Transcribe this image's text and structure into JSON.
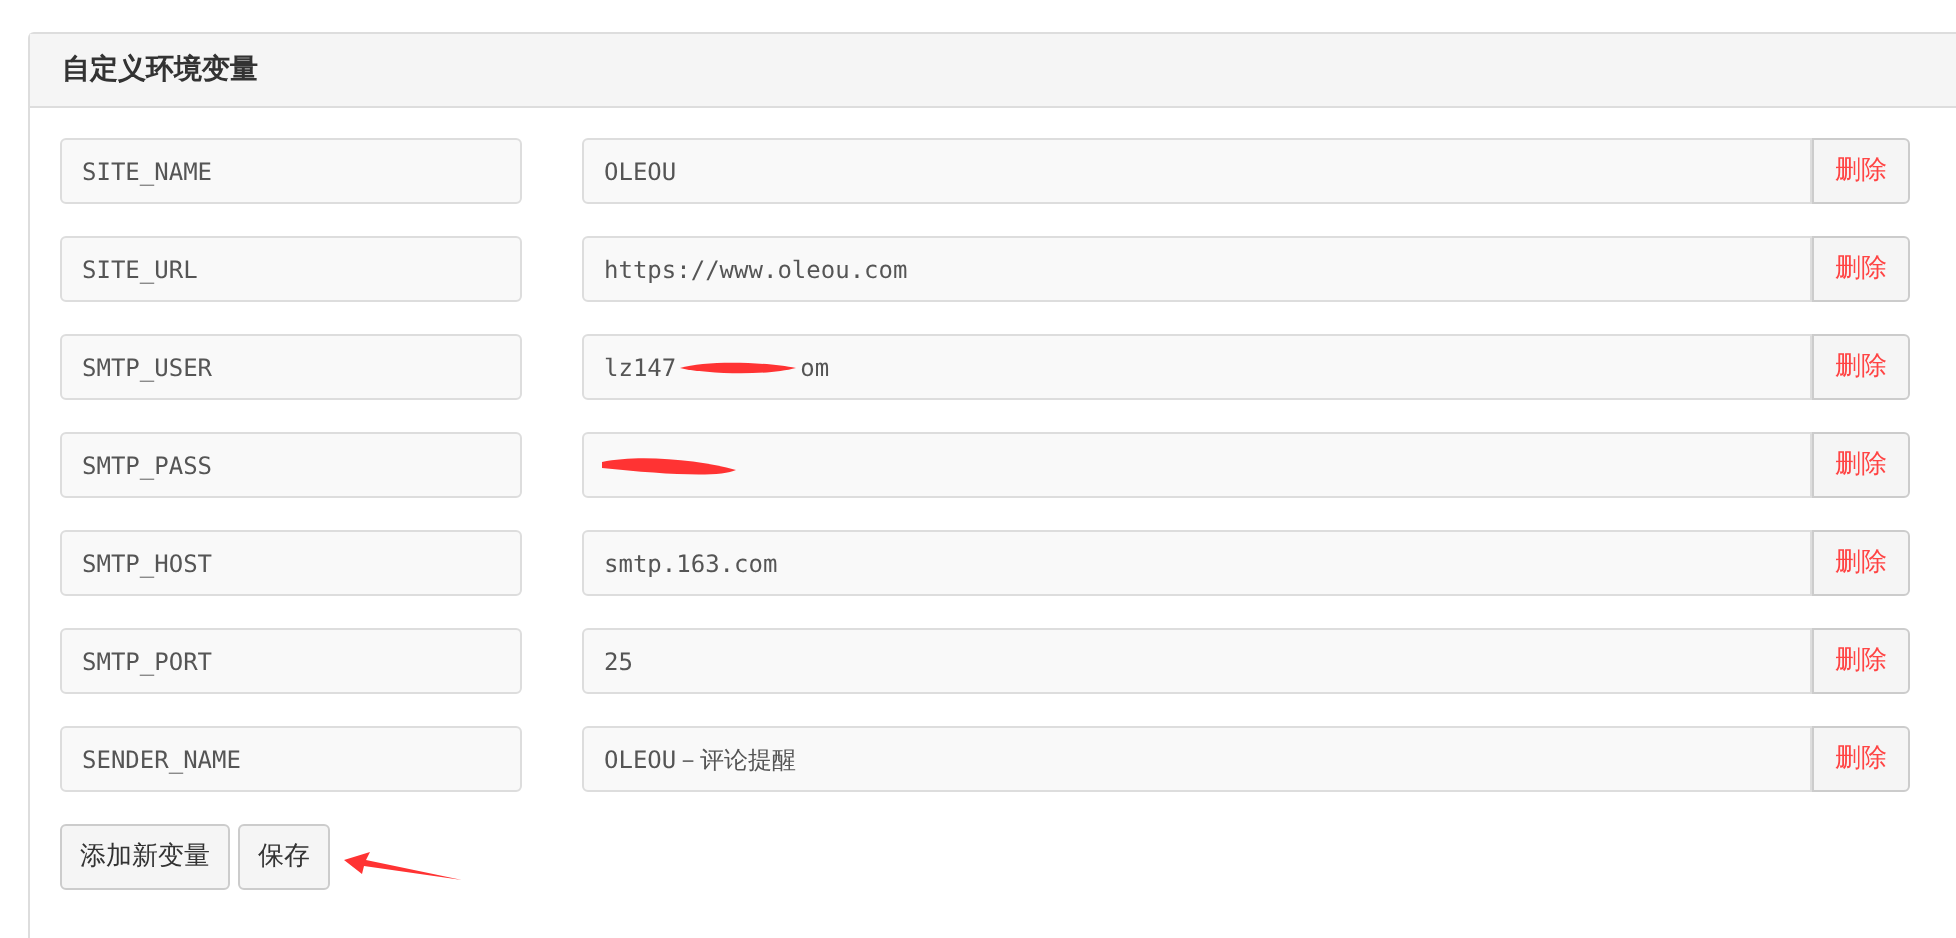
{
  "panel": {
    "title": "自定义环境变量"
  },
  "variables": [
    {
      "key": "SITE_NAME",
      "value": "OLEOU",
      "delete": "删除"
    },
    {
      "key": "SITE_URL",
      "value": "https://www.oleou.com",
      "delete": "删除"
    },
    {
      "key": "SMTP_USER",
      "redacted": true,
      "value_before": "lz147",
      "value_after": "om",
      "delete": "删除"
    },
    {
      "key": "SMTP_PASS",
      "redacted": true,
      "delete": "删除"
    },
    {
      "key": "SMTP_HOST",
      "value": "smtp.163.com",
      "delete": "删除"
    },
    {
      "key": "SMTP_PORT",
      "value": "25",
      "delete": "删除"
    },
    {
      "key": "SENDER_NAME",
      "value": "OLEOU－评论提醒",
      "delete": "删除"
    }
  ],
  "buttons": [
    "添加新变量",
    "保存"
  ]
}
